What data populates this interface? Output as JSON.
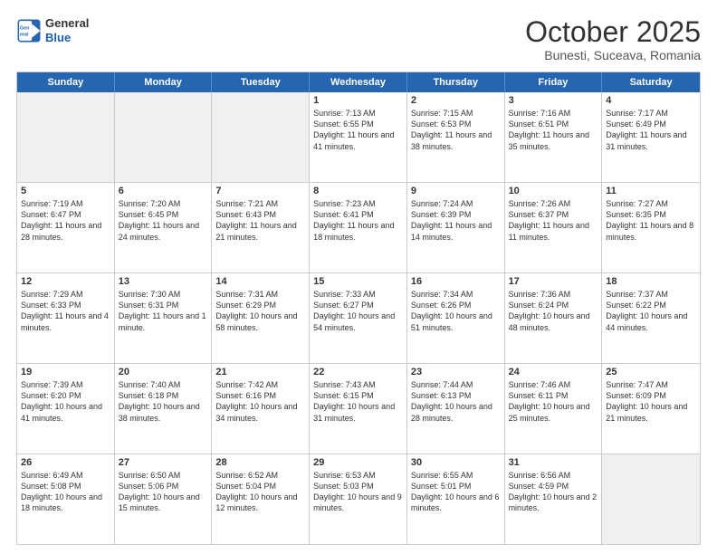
{
  "logo": {
    "line1": "General",
    "line2": "Blue"
  },
  "header": {
    "month": "October 2025",
    "location": "Bunesti, Suceava, Romania"
  },
  "days": [
    "Sunday",
    "Monday",
    "Tuesday",
    "Wednesday",
    "Thursday",
    "Friday",
    "Saturday"
  ],
  "rows": [
    [
      {
        "day": "",
        "content": ""
      },
      {
        "day": "",
        "content": ""
      },
      {
        "day": "",
        "content": ""
      },
      {
        "day": "1",
        "content": "Sunrise: 7:13 AM\nSunset: 6:55 PM\nDaylight: 11 hours and 41 minutes."
      },
      {
        "day": "2",
        "content": "Sunrise: 7:15 AM\nSunset: 6:53 PM\nDaylight: 11 hours and 38 minutes."
      },
      {
        "day": "3",
        "content": "Sunrise: 7:16 AM\nSunset: 6:51 PM\nDaylight: 11 hours and 35 minutes."
      },
      {
        "day": "4",
        "content": "Sunrise: 7:17 AM\nSunset: 6:49 PM\nDaylight: 11 hours and 31 minutes."
      }
    ],
    [
      {
        "day": "5",
        "content": "Sunrise: 7:19 AM\nSunset: 6:47 PM\nDaylight: 11 hours and 28 minutes."
      },
      {
        "day": "6",
        "content": "Sunrise: 7:20 AM\nSunset: 6:45 PM\nDaylight: 11 hours and 24 minutes."
      },
      {
        "day": "7",
        "content": "Sunrise: 7:21 AM\nSunset: 6:43 PM\nDaylight: 11 hours and 21 minutes."
      },
      {
        "day": "8",
        "content": "Sunrise: 7:23 AM\nSunset: 6:41 PM\nDaylight: 11 hours and 18 minutes."
      },
      {
        "day": "9",
        "content": "Sunrise: 7:24 AM\nSunset: 6:39 PM\nDaylight: 11 hours and 14 minutes."
      },
      {
        "day": "10",
        "content": "Sunrise: 7:26 AM\nSunset: 6:37 PM\nDaylight: 11 hours and 11 minutes."
      },
      {
        "day": "11",
        "content": "Sunrise: 7:27 AM\nSunset: 6:35 PM\nDaylight: 11 hours and 8 minutes."
      }
    ],
    [
      {
        "day": "12",
        "content": "Sunrise: 7:29 AM\nSunset: 6:33 PM\nDaylight: 11 hours and 4 minutes."
      },
      {
        "day": "13",
        "content": "Sunrise: 7:30 AM\nSunset: 6:31 PM\nDaylight: 11 hours and 1 minute."
      },
      {
        "day": "14",
        "content": "Sunrise: 7:31 AM\nSunset: 6:29 PM\nDaylight: 10 hours and 58 minutes."
      },
      {
        "day": "15",
        "content": "Sunrise: 7:33 AM\nSunset: 6:27 PM\nDaylight: 10 hours and 54 minutes."
      },
      {
        "day": "16",
        "content": "Sunrise: 7:34 AM\nSunset: 6:26 PM\nDaylight: 10 hours and 51 minutes."
      },
      {
        "day": "17",
        "content": "Sunrise: 7:36 AM\nSunset: 6:24 PM\nDaylight: 10 hours and 48 minutes."
      },
      {
        "day": "18",
        "content": "Sunrise: 7:37 AM\nSunset: 6:22 PM\nDaylight: 10 hours and 44 minutes."
      }
    ],
    [
      {
        "day": "19",
        "content": "Sunrise: 7:39 AM\nSunset: 6:20 PM\nDaylight: 10 hours and 41 minutes."
      },
      {
        "day": "20",
        "content": "Sunrise: 7:40 AM\nSunset: 6:18 PM\nDaylight: 10 hours and 38 minutes."
      },
      {
        "day": "21",
        "content": "Sunrise: 7:42 AM\nSunset: 6:16 PM\nDaylight: 10 hours and 34 minutes."
      },
      {
        "day": "22",
        "content": "Sunrise: 7:43 AM\nSunset: 6:15 PM\nDaylight: 10 hours and 31 minutes."
      },
      {
        "day": "23",
        "content": "Sunrise: 7:44 AM\nSunset: 6:13 PM\nDaylight: 10 hours and 28 minutes."
      },
      {
        "day": "24",
        "content": "Sunrise: 7:46 AM\nSunset: 6:11 PM\nDaylight: 10 hours and 25 minutes."
      },
      {
        "day": "25",
        "content": "Sunrise: 7:47 AM\nSunset: 6:09 PM\nDaylight: 10 hours and 21 minutes."
      }
    ],
    [
      {
        "day": "26",
        "content": "Sunrise: 6:49 AM\nSunset: 5:08 PM\nDaylight: 10 hours and 18 minutes."
      },
      {
        "day": "27",
        "content": "Sunrise: 6:50 AM\nSunset: 5:06 PM\nDaylight: 10 hours and 15 minutes."
      },
      {
        "day": "28",
        "content": "Sunrise: 6:52 AM\nSunset: 5:04 PM\nDaylight: 10 hours and 12 minutes."
      },
      {
        "day": "29",
        "content": "Sunrise: 6:53 AM\nSunset: 5:03 PM\nDaylight: 10 hours and 9 minutes."
      },
      {
        "day": "30",
        "content": "Sunrise: 6:55 AM\nSunset: 5:01 PM\nDaylight: 10 hours and 6 minutes."
      },
      {
        "day": "31",
        "content": "Sunrise: 6:56 AM\nSunset: 4:59 PM\nDaylight: 10 hours and 2 minutes."
      },
      {
        "day": "",
        "content": ""
      }
    ]
  ]
}
